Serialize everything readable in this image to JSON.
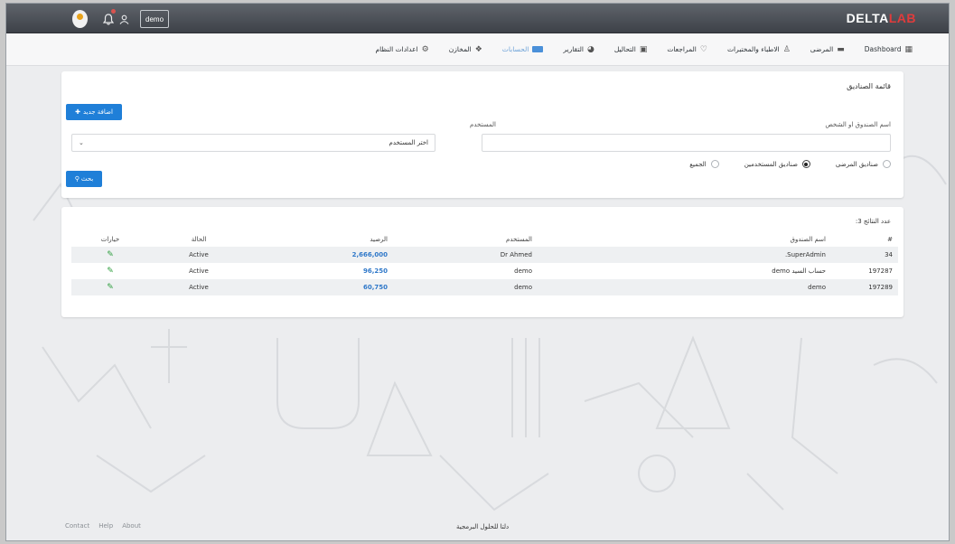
{
  "topbar": {
    "user_label": "demo",
    "brand_part1": "DELTA",
    "brand_part2": "LAB",
    "brand_accent": "#e23b3b",
    "icons": [
      "avatar-logo",
      "bell-icon",
      "user-icon"
    ]
  },
  "nav": {
    "items": [
      {
        "label": "Dashboard",
        "icon": "dashboard-icon"
      },
      {
        "label": "المرضى",
        "icon": "bed-icon"
      },
      {
        "label": "الاطباء والمختبرات",
        "icon": "doctor-icon"
      },
      {
        "label": "المراجعات",
        "icon": "heartbeat-icon"
      },
      {
        "label": "التحاليل",
        "icon": "medkit-icon"
      },
      {
        "label": "التقارير",
        "icon": "pie-chart-icon"
      },
      {
        "label": "الحسابات",
        "icon": "money-icon",
        "active": true
      },
      {
        "label": "المخازن",
        "icon": "cubes-icon"
      },
      {
        "label": "اعدادات النظام",
        "icon": "gear-icon"
      }
    ]
  },
  "filter_card": {
    "title": "قائمة الصناديق",
    "add_button": "اضافة جديد",
    "fund_label": "اسم الصندوق او الشخص",
    "fund_value": "",
    "user_label": "المستخدم",
    "user_select": "اختر المستخدم",
    "radios": [
      {
        "label": "الجميع",
        "checked": false
      },
      {
        "label": "صناديق المستخدمين",
        "checked": true
      },
      {
        "label": "صناديق المرضى",
        "checked": false
      }
    ],
    "search_button": "بحث"
  },
  "results": {
    "count_label": "عدد النتائج 3:",
    "columns": {
      "num": "#",
      "name": "اسم الصندوق",
      "user": "المستخدم",
      "balance": "الرصيد",
      "state": "الحالة",
      "options": "خيارات"
    },
    "rows": [
      {
        "num": "34",
        "name": "SuperAdmin.",
        "user": "Dr Ahmed",
        "balance": "2,666,000",
        "state": "Active"
      },
      {
        "num": "197287",
        "name": "حساب السيد demo",
        "user": "demo",
        "balance": "96,250",
        "state": "Active"
      },
      {
        "num": "197289",
        "name": "demo",
        "user": "demo",
        "balance": "60,750",
        "state": "Active"
      }
    ]
  },
  "footer": {
    "links": [
      "Contact",
      "Help",
      "About"
    ],
    "center_text": "دلتا للحلول البرمجية"
  }
}
